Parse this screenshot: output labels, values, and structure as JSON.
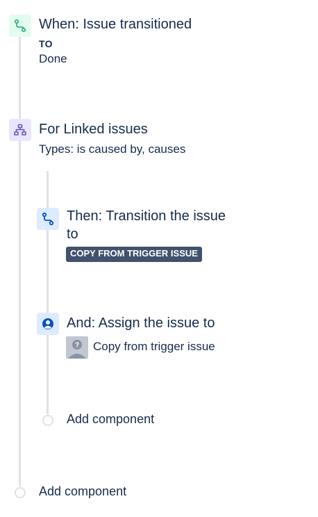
{
  "trigger": {
    "title": "When: Issue transitioned",
    "to_label": "TO",
    "to_value": "Done",
    "icon": "transition-icon"
  },
  "branch": {
    "title": "For Linked issues",
    "types": "Types: is caused by, causes",
    "icon": "branch-icon"
  },
  "actions": [
    {
      "title": "Then: Transition the issue to",
      "lozenge": "COPY FROM TRIGGER ISSUE",
      "icon": "transition-icon"
    },
    {
      "title": "And: Assign the issue to",
      "assignee": "Copy from trigger issue",
      "icon": "assign-user-icon"
    }
  ],
  "inner_add": "Add component",
  "outer_add": "Add component",
  "colors": {
    "trigger_icon": "#36b37e",
    "branch_icon": "#6554c0",
    "action_icon": "#0052cc",
    "line": "#dfe1e6"
  }
}
